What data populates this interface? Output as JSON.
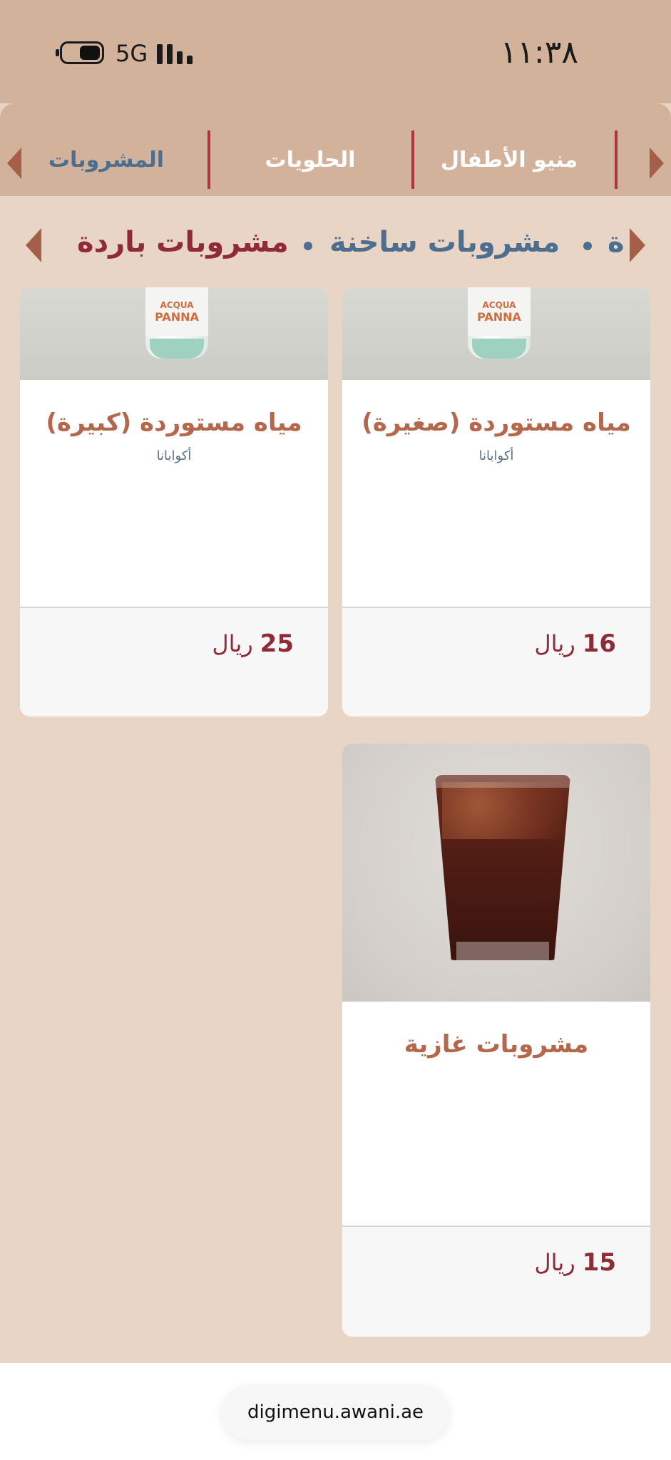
{
  "status_bar": {
    "time": "١١:٣٨",
    "network": "5G"
  },
  "categories": {
    "tabs": [
      {
        "label": "منيو الأطفال",
        "active": false
      },
      {
        "label": "الحلويات",
        "active": false
      },
      {
        "label": "المشروبات",
        "active": true
      }
    ]
  },
  "subcategories": {
    "items": [
      {
        "label": "ة",
        "active": false
      },
      {
        "label": "مشروبات ساخنة",
        "active": false
      },
      {
        "label": "مشروبات باردة",
        "active": true
      }
    ]
  },
  "products": [
    {
      "name": "مياه مستوردة (صغيرة)",
      "desc": "أكوابانا",
      "price": "16",
      "currency": "ريال",
      "image_icon": "water-bottle-image",
      "bottle_brand_top": "ACQUA",
      "bottle_brand_main": "PANNA"
    },
    {
      "name": "مياه مستوردة (كبيرة)",
      "desc": "أكوابانا",
      "price": "25",
      "currency": "ريال",
      "image_icon": "water-bottle-image",
      "bottle_brand_top": "ACQUA",
      "bottle_brand_main": "PANNA"
    },
    {
      "name": "مشروبات غازية",
      "desc": "",
      "price": "15",
      "currency": "ريال",
      "image_icon": "soda-glass-image"
    }
  ],
  "footer": {
    "url": "digimenu.awani.ae"
  },
  "colors": {
    "header_bg": "#d3b29c",
    "page_bg": "#e8d5c6",
    "accent_red": "#8f2a37",
    "accent_blue": "#4c6e8f",
    "product_name": "#b5674b"
  }
}
